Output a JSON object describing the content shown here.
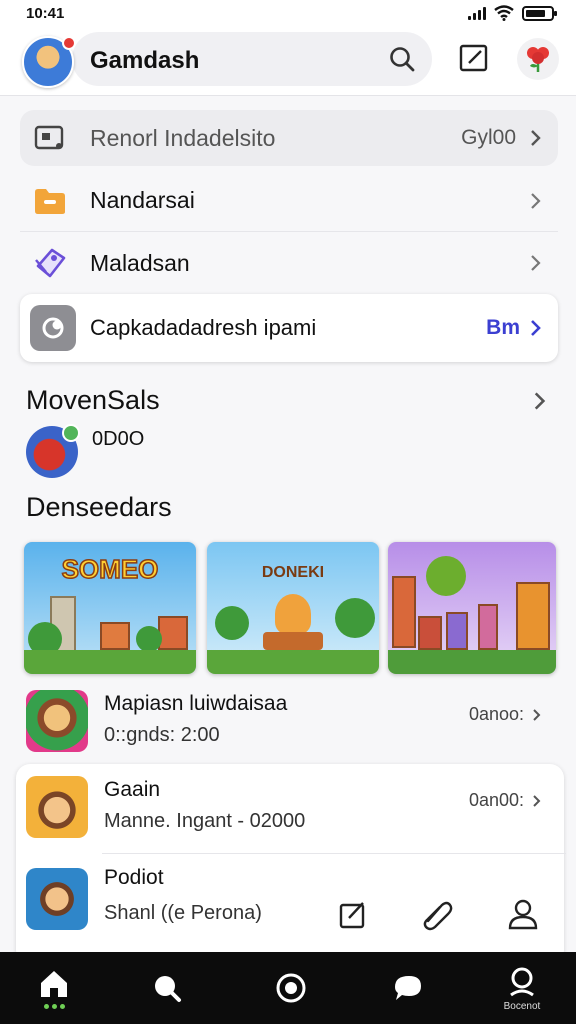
{
  "status": {
    "time": "10:41",
    "battery_level": 0.8
  },
  "header": {
    "title": "Gamdash"
  },
  "menu": [
    {
      "label": "Renorl Indadelsito",
      "value": "Gyl00",
      "icon": "search-card-icon"
    },
    {
      "label": "Nandarsai",
      "icon": "folder-icon"
    },
    {
      "label": "Maladsan",
      "icon": "tag-icon"
    },
    {
      "label": "Capkadadadresh ipami",
      "value": "Bm",
      "icon": "settings-toggle-icon"
    }
  ],
  "recent": {
    "title": "MovenSals",
    "count": "0D0O"
  },
  "featured": {
    "title": "Denseedars",
    "tiles": [
      {
        "caption": "SOMEO"
      },
      {
        "caption": "DONEKI"
      },
      {
        "caption": ""
      }
    ]
  },
  "games": [
    {
      "title": "Mapiasn luiwdaisaa",
      "subtitle": "0::gnds: 2:00",
      "meta": "0anoo:"
    },
    {
      "title": "Gaain",
      "subtitle": "Manne. Ingant - 02000",
      "meta": "0an00:"
    },
    {
      "title": "Podiot",
      "subtitle": "Shanl ((e Perona)",
      "meta": ""
    }
  ],
  "tabs": [
    {
      "name": "home",
      "label": ""
    },
    {
      "name": "search",
      "label": ""
    },
    {
      "name": "camera",
      "label": ""
    },
    {
      "name": "chat",
      "label": ""
    },
    {
      "name": "profile",
      "label": "Bocenot"
    }
  ],
  "colors": {
    "accent": "#3b3fd1",
    "tab_bg": "#0c0c0c",
    "folder": "#f2a53a",
    "tag": "#6b4fd8"
  }
}
